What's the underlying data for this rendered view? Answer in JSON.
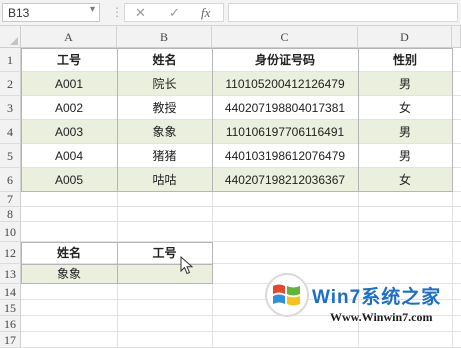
{
  "formula_bar": {
    "name_box": "B13",
    "dropdown_glyph": "▾",
    "menu_glyph": "⋮",
    "cancel_glyph": "✕",
    "confirm_glyph": "✓",
    "fx_label": "fx",
    "formula_value": ""
  },
  "columns": [
    "A",
    "B",
    "C",
    "D"
  ],
  "rows": [
    {
      "num": "1"
    },
    {
      "num": "2"
    },
    {
      "num": "3"
    },
    {
      "num": "4"
    },
    {
      "num": "5"
    },
    {
      "num": "6"
    },
    {
      "num": "7"
    },
    {
      "num": "8"
    },
    {
      "num": "10"
    },
    {
      "num": "12"
    },
    {
      "num": "13"
    },
    {
      "num": "14"
    },
    {
      "num": "15"
    },
    {
      "num": "16"
    },
    {
      "num": "17"
    }
  ],
  "table": {
    "headers": [
      "工号",
      "姓名",
      "身份证号码",
      "性别"
    ],
    "records": [
      [
        "A001",
        "院长",
        "110105200412126479",
        "男"
      ],
      [
        "A002",
        "教授",
        "440207198804017381",
        "女"
      ],
      [
        "A003",
        "象象",
        "110106197706116491",
        "男"
      ],
      [
        "A004",
        "猪猪",
        "440103198612076479",
        "男"
      ],
      [
        "A005",
        "咕咕",
        "440207198212036367",
        "女"
      ]
    ]
  },
  "lookup": {
    "headers": [
      "姓名",
      "工号"
    ],
    "values": [
      "象象",
      ""
    ]
  },
  "colors": {
    "band": "#eaf0dd",
    "header_fill": "#f2f2f2",
    "gridline": "#e2e2e2"
  },
  "watermark": {
    "brand": "Win7系统之家",
    "url": "Www.Winwin7.com"
  }
}
